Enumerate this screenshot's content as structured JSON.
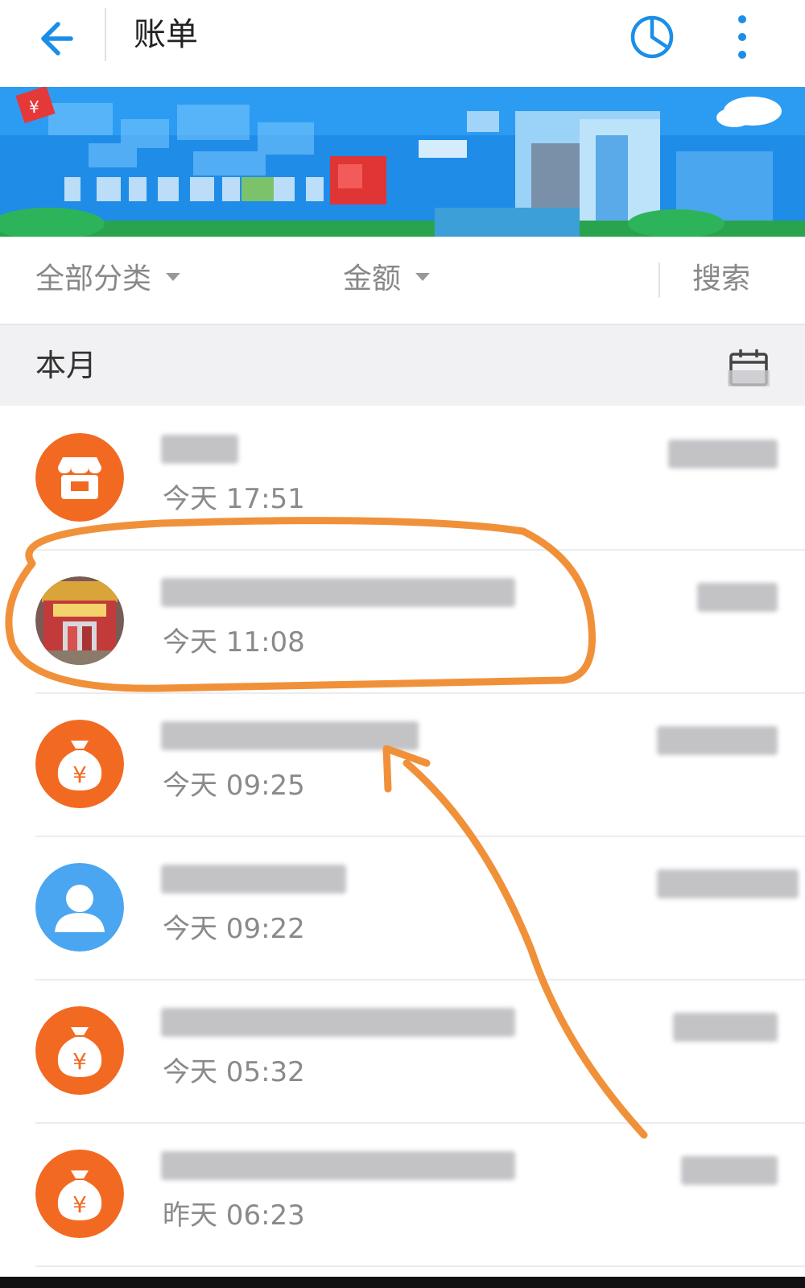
{
  "header": {
    "title": "账单"
  },
  "filters": {
    "category": "全部分类",
    "amount": "金额",
    "search": "搜索"
  },
  "section": {
    "month": "本月"
  },
  "transactions": [
    {
      "time": "今天  17:51",
      "icon": "shop-icon"
    },
    {
      "time": "今天  11:08",
      "icon": "store-photo"
    },
    {
      "time": "今天  09:25",
      "icon": "money-bag-icon"
    },
    {
      "time": "今天  09:22",
      "icon": "person-icon"
    },
    {
      "time": "今天  05:32",
      "icon": "money-bag-icon"
    },
    {
      "time": "昨天  06:23",
      "icon": "money-bag-icon"
    }
  ],
  "colors": {
    "accent": "#1a8ee8",
    "orange": "#f26a22",
    "blue_avatar": "#4aa6f0",
    "annotation": "#f0913a"
  }
}
